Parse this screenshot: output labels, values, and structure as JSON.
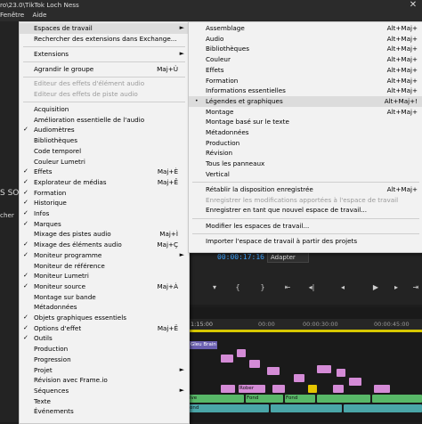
{
  "app": {
    "title": "ro\\23.0\\TikTok Loch Ness",
    "menubar": [
      "Fenêtre",
      "Aide"
    ],
    "left_panel_texts": [
      "S SOU",
      "cher"
    ],
    "timecode": "00:00:17:16",
    "fit_select": "Adapter",
    "ruler_start": "1:15:00",
    "ruler_ticks": [
      "00:00",
      "00:00:30:00",
      "00:00:45:00"
    ],
    "clip_labels": [
      "Gleu Brain",
      "Rober",
      "Fond",
      "Fond",
      "ive",
      "ond"
    ]
  },
  "main_menu": {
    "items": [
      {
        "label": "Espaces de travail",
        "arrow": "►",
        "highlight": true
      },
      {
        "label": "Rechercher des extensions dans Exchange..."
      },
      {
        "sep": true
      },
      {
        "label": "Extensions",
        "arrow": "►"
      },
      {
        "sep": true
      },
      {
        "label": "Agrandir le groupe",
        "shortcut": "Maj+Ù"
      },
      {
        "sep": true
      },
      {
        "label": "Editeur des effets d'élément audio",
        "disabled": true
      },
      {
        "label": "Editeur des effets de piste audio",
        "disabled": true
      },
      {
        "sep": true
      },
      {
        "label": "Acquisition"
      },
      {
        "label": "Amélioration essentielle de l'audio"
      },
      {
        "label": "Audiomètres",
        "check": true
      },
      {
        "label": "Bibliothèques"
      },
      {
        "label": "Code temporel"
      },
      {
        "label": "Couleur Lumetri"
      },
      {
        "label": "Effets",
        "check": true,
        "shortcut": "Maj+È"
      },
      {
        "label": "Explorateur de médias",
        "check": true,
        "shortcut": "Maj+Ê"
      },
      {
        "label": "Formation",
        "check": true
      },
      {
        "label": "Historique",
        "check": true
      },
      {
        "label": "Infos",
        "check": true
      },
      {
        "label": "Marques",
        "check": true
      },
      {
        "label": "Mixage des pistes audio",
        "shortcut": "Maj+Ì"
      },
      {
        "label": "Mixage des éléments audio",
        "check": true,
        "shortcut": "Maj+Ç"
      },
      {
        "label": "Moniteur programme",
        "check": true,
        "arrow": "►"
      },
      {
        "label": "Moniteur de référence"
      },
      {
        "label": "Moniteur Lumetri",
        "check": true
      },
      {
        "label": "Moniteur source",
        "check": true,
        "shortcut": "Maj+À"
      },
      {
        "label": "Montage sur bande"
      },
      {
        "label": "Métadonnées"
      },
      {
        "label": "Objets graphiques essentiels",
        "check": true
      },
      {
        "label": "Options d'effet",
        "check": true,
        "shortcut": "Maj+Ë"
      },
      {
        "label": "Outils",
        "check": true
      },
      {
        "label": "Production"
      },
      {
        "label": "Progression"
      },
      {
        "label": "Projet",
        "arrow": "►"
      },
      {
        "label": "Révision avec Frame.io"
      },
      {
        "label": "Séquences",
        "arrow": "►"
      },
      {
        "label": "Texte"
      },
      {
        "label": "Événements"
      }
    ]
  },
  "sub_menu": {
    "items": [
      {
        "label": "Assemblage",
        "shortcut": "Alt+Maj+"
      },
      {
        "label": "Audio",
        "shortcut": "Alt+Maj+"
      },
      {
        "label": "Bibliothèques",
        "shortcut": "Alt+Maj+"
      },
      {
        "label": "Couleur",
        "shortcut": "Alt+Maj+"
      },
      {
        "label": "Effets",
        "shortcut": "Alt+Maj+"
      },
      {
        "label": "Formation",
        "shortcut": "Alt+Maj+"
      },
      {
        "label": "Informations essentielles",
        "shortcut": "Alt+Maj+"
      },
      {
        "label": "Légendes et graphiques",
        "shortcut": "Alt+Maj+!",
        "bullet": true,
        "highlight": true
      },
      {
        "label": "Montage",
        "shortcut": "Alt+Maj+"
      },
      {
        "label": "Montage basé sur le texte"
      },
      {
        "label": "Métadonnées"
      },
      {
        "label": "Production"
      },
      {
        "label": "Révision"
      },
      {
        "label": "Tous les panneaux"
      },
      {
        "label": "Vertical"
      },
      {
        "sep": true
      },
      {
        "label": "Rétablir la disposition enregistrée",
        "shortcut": "Alt+Maj+"
      },
      {
        "label": "Enregistrer les modifications apportées à l'espace de travail",
        "disabled": true
      },
      {
        "label": "Enregistrer en tant que nouvel espace de travail..."
      },
      {
        "sep": true
      },
      {
        "label": "Modifier les espaces de travail..."
      },
      {
        "sep": true
      },
      {
        "label": "Importer l'espace de travail à partir des projets"
      }
    ]
  }
}
